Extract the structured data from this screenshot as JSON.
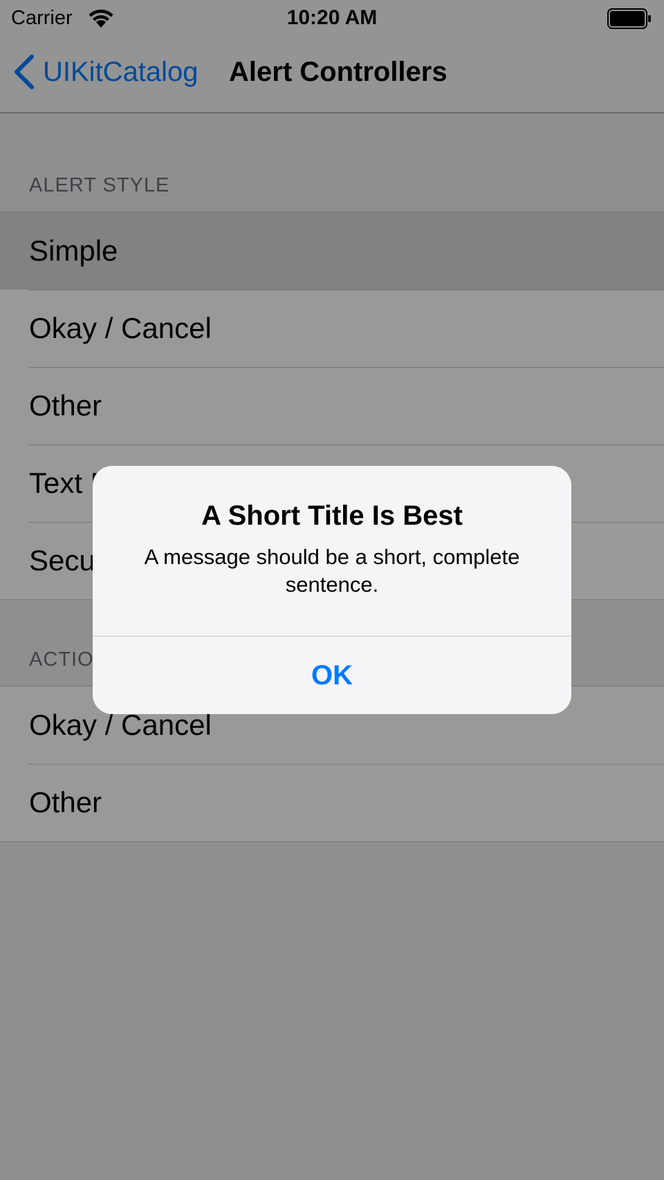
{
  "status_bar": {
    "carrier": "Carrier",
    "time": "10:20 AM",
    "wifi_icon": "wifi-icon",
    "battery_icon": "battery-full-icon"
  },
  "nav_bar": {
    "back_label": "UIKitCatalog",
    "back_icon": "chevron-left-icon",
    "title": "Alert Controllers",
    "tint_color": "#007aff"
  },
  "sections": [
    {
      "header": "ALERT STYLE",
      "rows": [
        "Simple",
        "Okay / Cancel",
        "Other",
        "Text Entry",
        "Secure Text Entry"
      ]
    },
    {
      "header": "ACTION SHEET STYLE",
      "rows": [
        "Okay / Cancel",
        "Other"
      ]
    }
  ],
  "alert": {
    "title": "A Short Title Is Best",
    "message": "A message should be a short, complete sentence.",
    "button_label": "OK"
  }
}
